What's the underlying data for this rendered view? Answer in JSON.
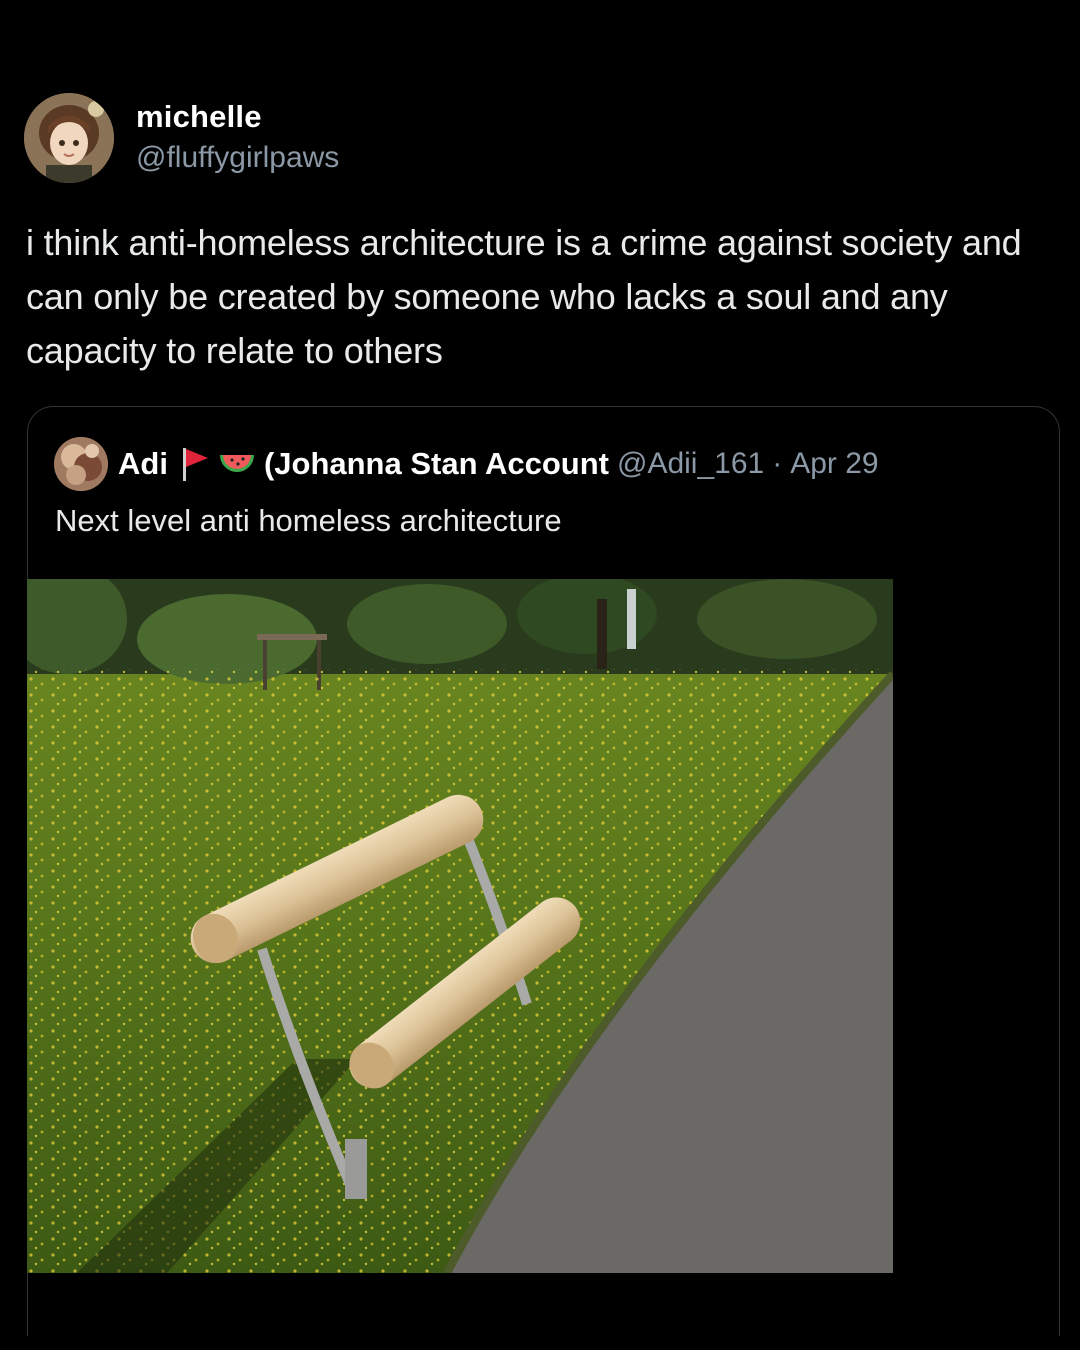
{
  "author": {
    "display_name": "michelle",
    "handle": "@fluffygirlpaws"
  },
  "tweet": {
    "text": "i think anti-homeless architecture is a crime against society and can only be created by someone who lacks a soul and any capacity to relate to others"
  },
  "quoted": {
    "name": "Adi",
    "emoji": [
      "triangular-flag-icon",
      "watermelon-icon"
    ],
    "nickname": "(Johanna Stan Account",
    "handle": "@Adii_161",
    "separator": "·",
    "date": "Apr 29",
    "text": "Next level anti homeless architecture",
    "image": "photo of a split wooden bench with metal supports beside a paved path in a grassy field"
  },
  "colors": {
    "background": "#000000",
    "primary_text": "#e7e9ea",
    "secondary_text": "#8b98a5",
    "border": "#2f3336"
  }
}
